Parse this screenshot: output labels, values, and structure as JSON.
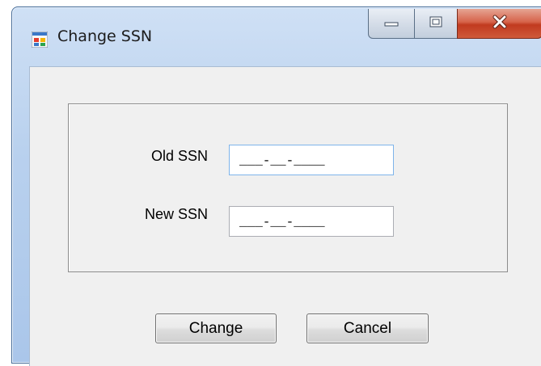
{
  "window": {
    "title": "Change SSN",
    "icon": "windows-form-icon",
    "controls": [
      "minimize-icon",
      "maximize-icon",
      "close-icon"
    ]
  },
  "form": {
    "old_ssn_label": "Old SSN",
    "old_ssn_value": "___-__-____",
    "new_ssn_label": "New SSN",
    "new_ssn_value": "___-__-____"
  },
  "buttons": {
    "change_label": "Change",
    "cancel_label": "Cancel"
  },
  "colors": {
    "frame": "#b9d1ee",
    "close_button": "#c13a1f",
    "client": "#f0f0f0",
    "focus_border": "#7eb4ea"
  }
}
